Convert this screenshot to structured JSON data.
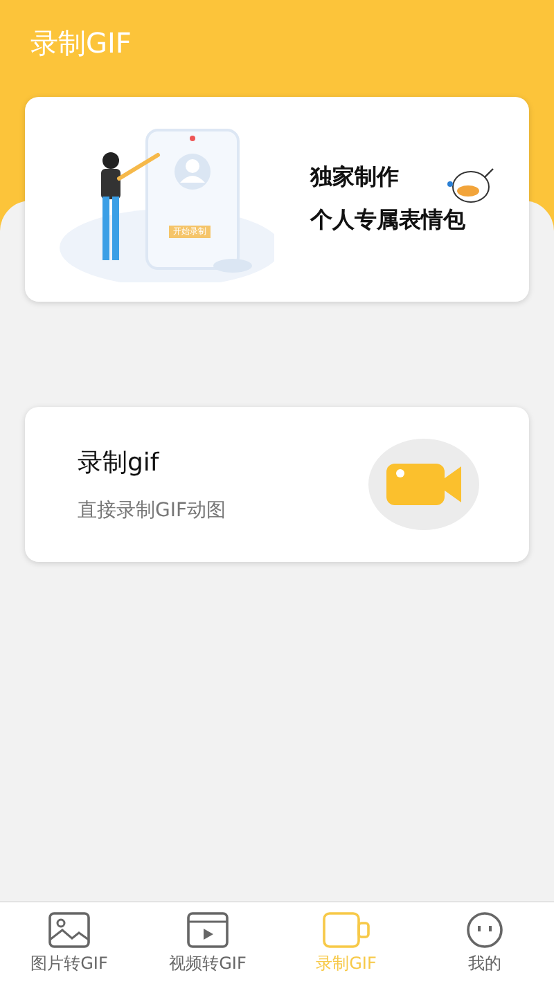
{
  "header": {
    "title": "录制GIF"
  },
  "banner": {
    "button_text": "开始录制",
    "lines": [
      "独家制作",
      "个人专属表情包"
    ]
  },
  "record_card": {
    "title": "录制gif",
    "subtitle": "直接录制GIF动图"
  },
  "tabs": [
    {
      "label": "图片转GIF",
      "selected": false
    },
    {
      "label": "视频转GIF",
      "selected": false
    },
    {
      "label": "录制GIF",
      "selected": true
    },
    {
      "label": "我的",
      "selected": false
    }
  ]
}
